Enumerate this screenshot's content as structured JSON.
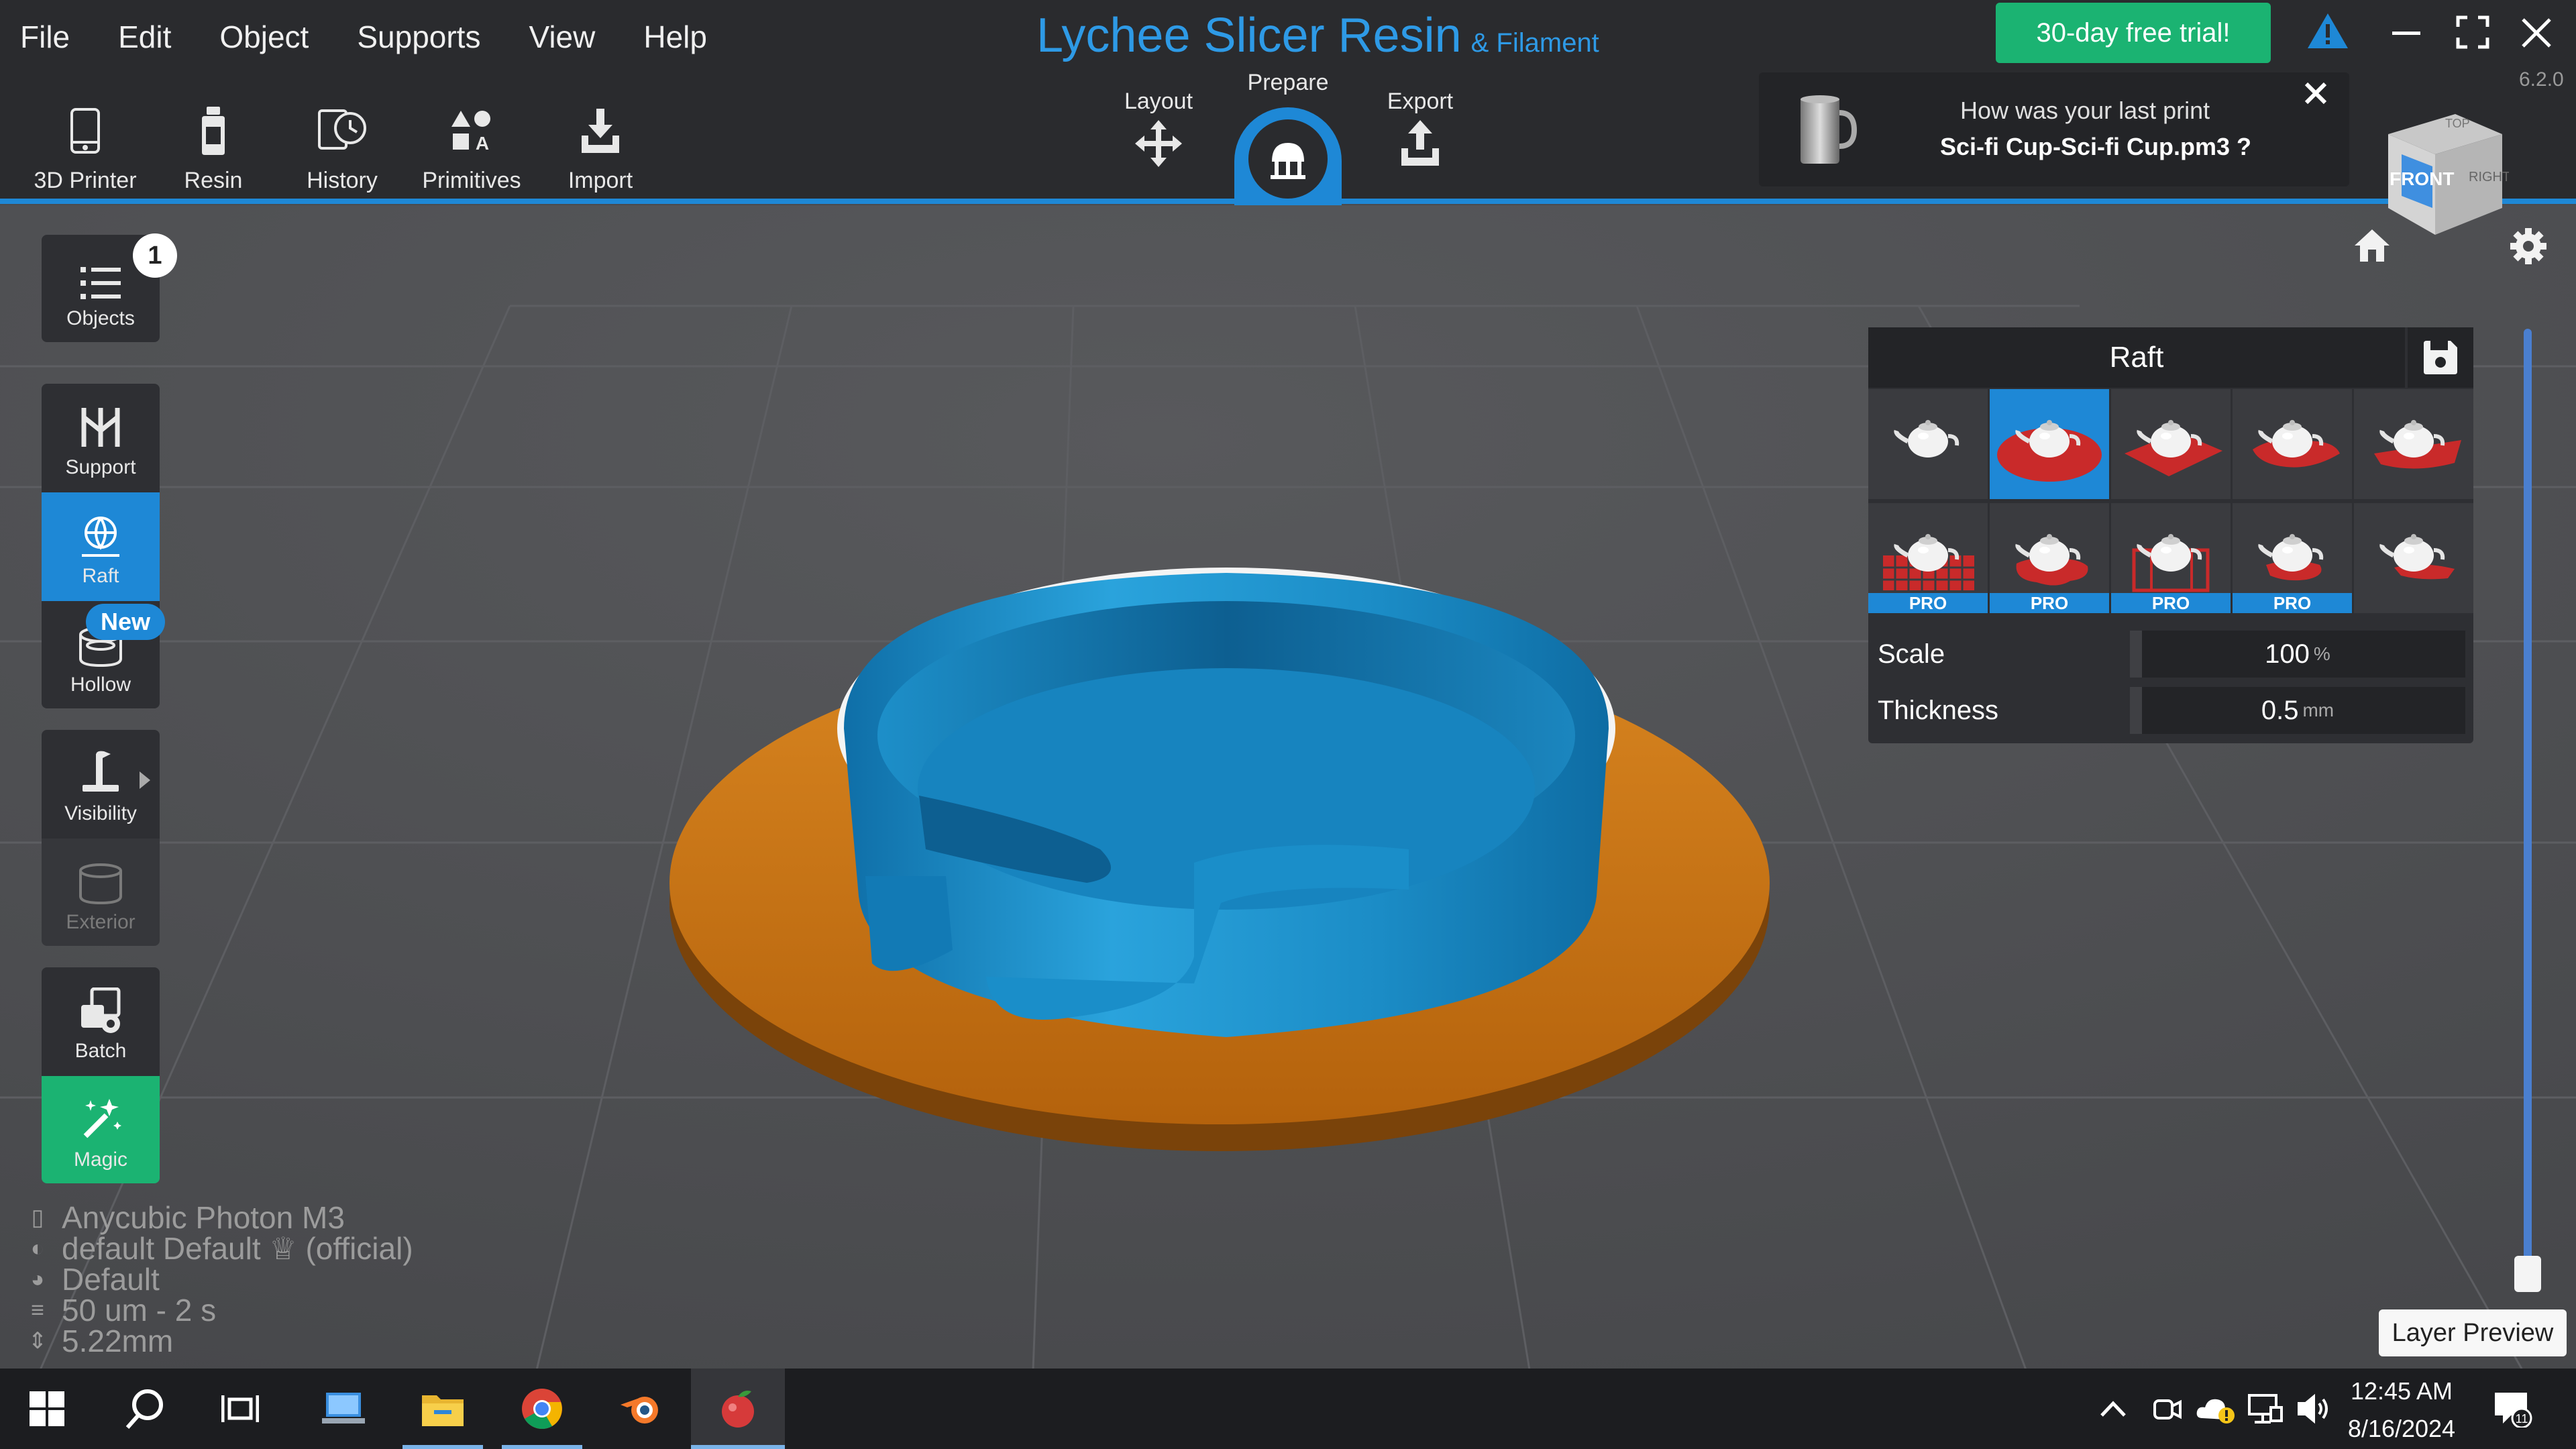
{
  "menu": [
    "File",
    "Edit",
    "Object",
    "Supports",
    "View",
    "Help"
  ],
  "app": {
    "title": "Lychee Slicer Resin",
    "subtitle": "& Filament",
    "version": "6.2.0"
  },
  "trial_button": "30-day free trial!",
  "toolbar": [
    {
      "label": "3D Printer",
      "icon": "printer-icon"
    },
    {
      "label": "Resin",
      "icon": "resin-bottle-icon"
    },
    {
      "label": "History",
      "icon": "history-icon"
    },
    {
      "label": "Primitives",
      "icon": "primitives-icon"
    },
    {
      "label": "Import",
      "icon": "import-icon"
    }
  ],
  "stages": {
    "layout": "Layout",
    "prepare": "Prepare",
    "export": "Export"
  },
  "notification": {
    "line1": "How was your last print",
    "line2": "Sci-fi Cup-Sci-fi Cup.pm3 ?"
  },
  "viewcube": {
    "top": "TOP",
    "front": "FRONT",
    "right": "RIGHT"
  },
  "sidebar": {
    "objects": {
      "label": "Objects",
      "badge": "1"
    },
    "support": "Support",
    "raft": "Raft",
    "hollow": "Hollow",
    "new_badge": "New",
    "visibility": "Visibility",
    "exterior": "Exterior",
    "batch": "Batch",
    "magic": "Magic"
  },
  "printer_info": [
    "Anycubic Photon M3",
    "default Default ♕ (official)",
    "Default",
    "50 um - 2 s",
    "5.22mm"
  ],
  "raft_panel": {
    "title": "Raft",
    "pro_label": "PRO",
    "selected_index": 1,
    "scale": {
      "label": "Scale",
      "value": "100",
      "unit": "%"
    },
    "thickness": {
      "label": "Thickness",
      "value": "0.5",
      "unit": "mm"
    }
  },
  "layer_preview": "Layer Preview",
  "clock": {
    "time": "12:45 AM",
    "date": "8/16/2024"
  },
  "notifications_count": "11",
  "colors": {
    "accent": "#1e88d6",
    "trial": "#1bb372",
    "model": "#1a8ec9",
    "raft": "#d07a16"
  }
}
